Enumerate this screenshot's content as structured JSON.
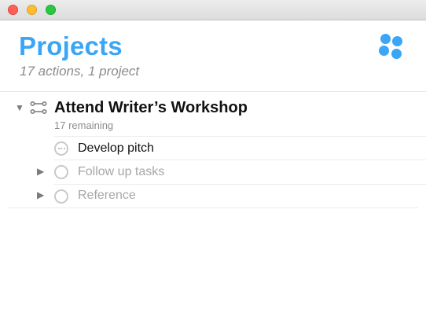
{
  "window": {
    "title": ""
  },
  "header": {
    "title": "Projects",
    "subtitle": "17 actions, 1 project",
    "perspective_icon": "four-dots-perspective-icon",
    "accent_color": "#3aa6f5"
  },
  "project": {
    "title": "Attend Writer’s Workshop",
    "remaining": "17 remaining",
    "expanded": true,
    "icon": "sequential-project-icon"
  },
  "items": [
    {
      "label": "Develop pitch",
      "status": "in-progress",
      "expandable": false,
      "dimmed": false
    },
    {
      "label": "Follow up tasks",
      "status": "empty",
      "expandable": true,
      "dimmed": true
    },
    {
      "label": "Reference",
      "status": "empty",
      "expandable": true,
      "dimmed": true
    }
  ]
}
